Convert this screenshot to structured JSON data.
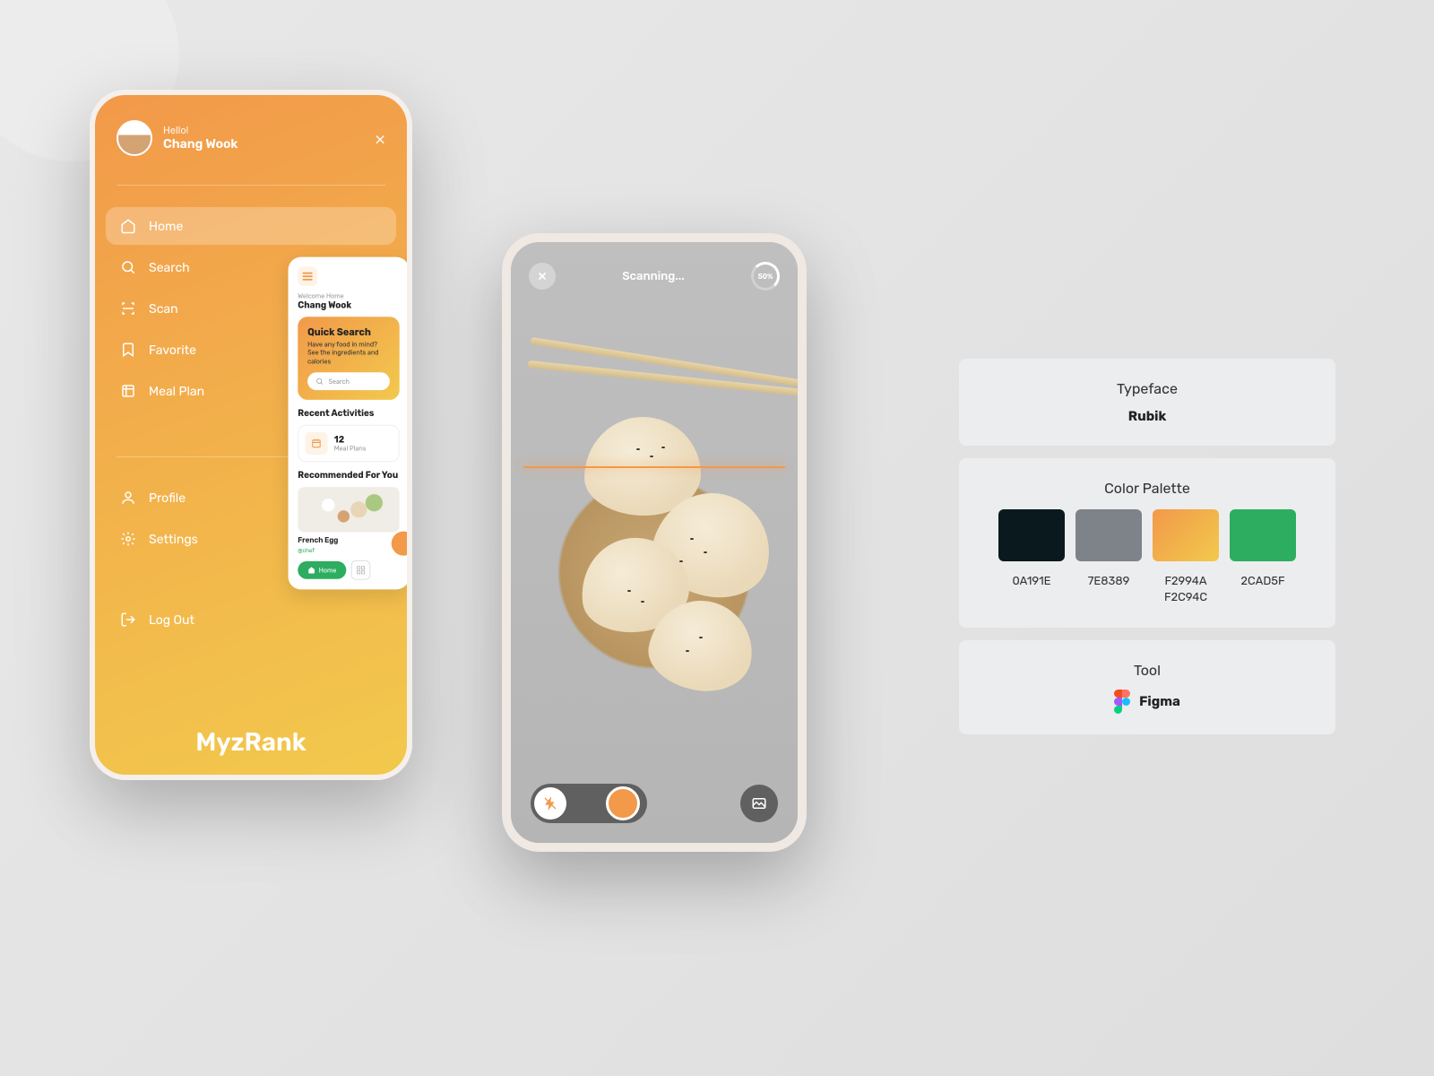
{
  "phone1": {
    "greeting": "Hello!",
    "username": "Chang  Wook",
    "nav": [
      {
        "label": "Home",
        "icon": "home"
      },
      {
        "label": "Search",
        "icon": "search"
      },
      {
        "label": "Scan",
        "icon": "scan"
      },
      {
        "label": "Favorite",
        "icon": "favorite"
      },
      {
        "label": "Meal Plan",
        "icon": "meal"
      }
    ],
    "nav2": [
      {
        "label": "Profile",
        "icon": "profile"
      },
      {
        "label": "Settings",
        "icon": "settings"
      }
    ],
    "logout": "Log Out",
    "brand": "MyzRank"
  },
  "homecard": {
    "welcome": "Welcome Home",
    "name": "Chang Wook",
    "quick_title": "Quick Search",
    "quick_sub": "Have any food in mind? See the ingredients and calories",
    "search_placeholder": "Search",
    "recent_title": "Recent Activities",
    "recent_num": "12",
    "recent_label": "Meal Plans",
    "reco_title": "Recommended For You",
    "reco_name": "French Egg",
    "reco_sub": "@chef",
    "home_btn": "Home"
  },
  "phone2": {
    "scanning": "Scanning...",
    "progress": "50%"
  },
  "panel": {
    "typeface_label": "Typeface",
    "typeface": "Rubik",
    "palette_label": "Color Palette",
    "colors": [
      {
        "hex": "#0A191E",
        "label": "0A191E"
      },
      {
        "hex": "#7E8389",
        "label": "7E8389"
      },
      {
        "grad": [
          "#F2994A",
          "#F2C94C"
        ],
        "label": "F2994A\nF2C94C"
      },
      {
        "hex": "#2CAD5F",
        "label": "2CAD5F"
      }
    ],
    "tool_label": "Tool",
    "tool": "Figma"
  }
}
